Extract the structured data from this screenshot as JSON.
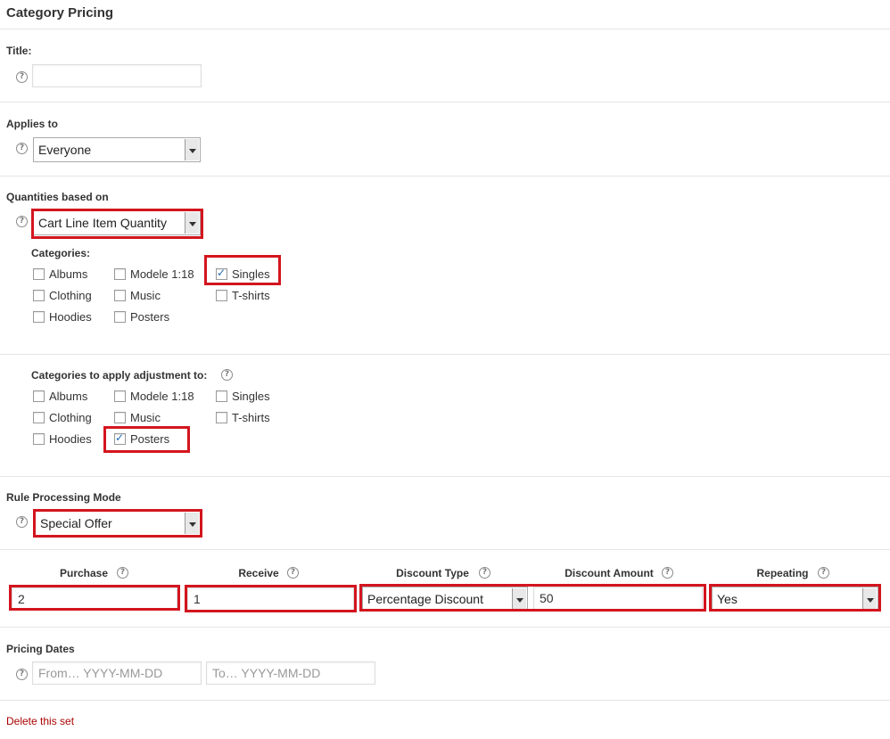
{
  "title": "Category Pricing",
  "title_field": {
    "label": "Title:",
    "value": ""
  },
  "applies_to": {
    "label": "Applies to",
    "value": "Everyone"
  },
  "quantities": {
    "label": "Quantities based on",
    "value": "Cart Line Item Quantity"
  },
  "categories": {
    "label": "Categories:",
    "items": [
      {
        "label": "Albums",
        "checked": false
      },
      {
        "label": "Clothing",
        "checked": false
      },
      {
        "label": "Hoodies",
        "checked": false
      },
      {
        "label": "Modele 1:18",
        "checked": false
      },
      {
        "label": "Music",
        "checked": false
      },
      {
        "label": "Posters",
        "checked": false
      },
      {
        "label": "Singles",
        "checked": true
      },
      {
        "label": "T-shirts",
        "checked": false
      }
    ]
  },
  "adjust": {
    "label": "Categories to apply adjustment to:",
    "items": [
      {
        "label": "Albums",
        "checked": false
      },
      {
        "label": "Clothing",
        "checked": false
      },
      {
        "label": "Hoodies",
        "checked": false
      },
      {
        "label": "Modele 1:18",
        "checked": false
      },
      {
        "label": "Music",
        "checked": false
      },
      {
        "label": "Posters",
        "checked": true
      },
      {
        "label": "Singles",
        "checked": false
      },
      {
        "label": "T-shirts",
        "checked": false
      }
    ]
  },
  "mode": {
    "label": "Rule Processing Mode",
    "value": "Special Offer"
  },
  "offer": {
    "purchase_label": "Purchase",
    "purchase_value": "2",
    "receive_label": "Receive",
    "receive_value": "1",
    "discount_type_label": "Discount Type",
    "discount_type_value": "Percentage Discount",
    "discount_amount_label": "Discount Amount",
    "discount_amount_value": "50",
    "repeating_label": "Repeating",
    "repeating_value": "Yes"
  },
  "dates": {
    "label": "Pricing Dates",
    "from_placeholder": "From… YYYY-MM-DD",
    "to_placeholder": "To… YYYY-MM-DD"
  },
  "delete_label": "Delete this set",
  "help_glyph": "?",
  "colors": {
    "highlight": "#d3151e",
    "link": "#aa0000"
  }
}
